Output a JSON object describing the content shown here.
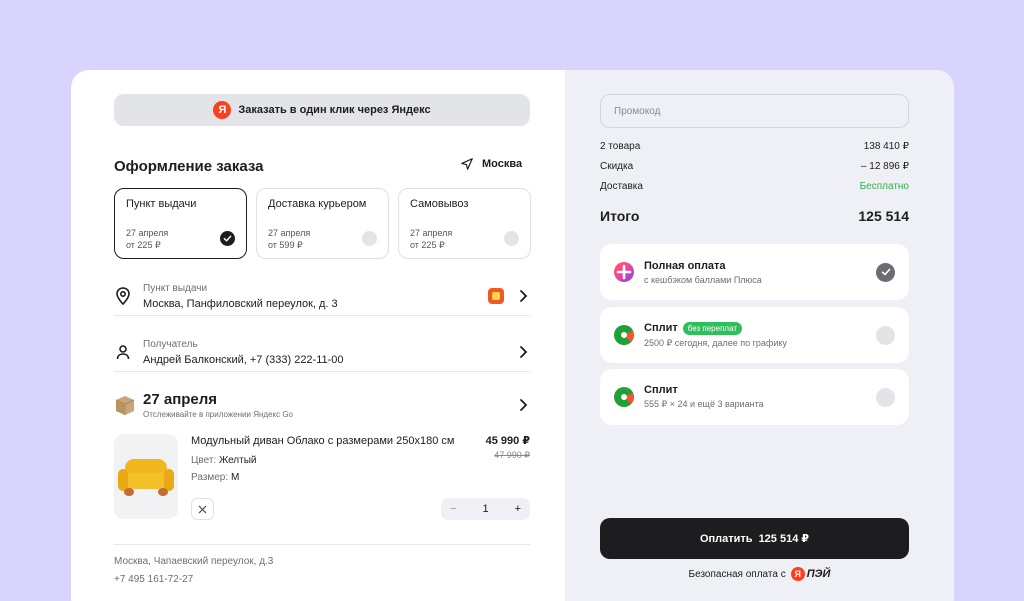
{
  "yandex_button": {
    "label": "Заказать в один клик через Яндекс",
    "logo": "Я"
  },
  "order": {
    "title": "Оформление заказа",
    "city": "Москва",
    "delivery_options": [
      {
        "title": "Пункт выдачи",
        "date": "27 апреля",
        "price": "от 225 ₽",
        "selected": true
      },
      {
        "title": "Доставка курьером",
        "date": "27 апреля",
        "price": "от 599 ₽",
        "selected": false
      },
      {
        "title": "Самовывоз",
        "date": "27 апреля",
        "price": "от 225 ₽",
        "selected": false
      }
    ],
    "pickup": {
      "label": "Пункт выдачи",
      "value": "Москва, Панфиловский переулок, д. 3"
    },
    "recipient": {
      "label": "Получатель",
      "value": "Андрей Балконский, +7 (333) 222-11-00"
    },
    "delivery_date": {
      "title": "27 апреля",
      "subtitle": "Отслеживайте в приложении Яндекс Go"
    },
    "product": {
      "name": "Модульный диван Облако с размерами 250х180 см",
      "price": "45 990 ₽",
      "old_price": "47 990 ₽",
      "color_label": "Цвет:",
      "color_value": "Желтый",
      "size_label": "Размер:",
      "size_value": "M",
      "quantity": "1",
      "minus": "−",
      "plus": "+"
    },
    "footer": {
      "address": "Москва, Чапаевский переулок, д.3",
      "phone": "+7 495 161-72-27"
    }
  },
  "summary": {
    "promo_placeholder": "Промокод",
    "items_label": "2 товара",
    "items_value": "138 410 ₽",
    "discount_label": "Скидка",
    "discount_value": "– 12 896 ₽",
    "shipping_label": "Доставка",
    "shipping_value": "Бесплатно",
    "total_label": "Итого",
    "total_value": "125 514",
    "payment_options": [
      {
        "title": "Полная оплата",
        "badge": "",
        "subtitle": "с кешбэком баллами Плюса",
        "selected": true
      },
      {
        "title": "Сплит",
        "badge": "без переплат",
        "subtitle": "2500 ₽ сегодня, далее по графику",
        "selected": false
      },
      {
        "title": "Сплит",
        "badge": "",
        "subtitle": "555 ₽ × 24 и ещё 3 варианта",
        "selected": false
      }
    ],
    "pay_button": {
      "label": "Оплатить",
      "amount": "125 514 ₽"
    },
    "secure_text": "Безопасная оплата с",
    "yapay_logo": "Я",
    "yapay_text": "ПЭЙ"
  },
  "colors": {
    "background": "#d9d4fd",
    "accent_green": "#2fb24c",
    "yandex_red": "#fc3f1d",
    "dark": "#1d1d1f"
  }
}
